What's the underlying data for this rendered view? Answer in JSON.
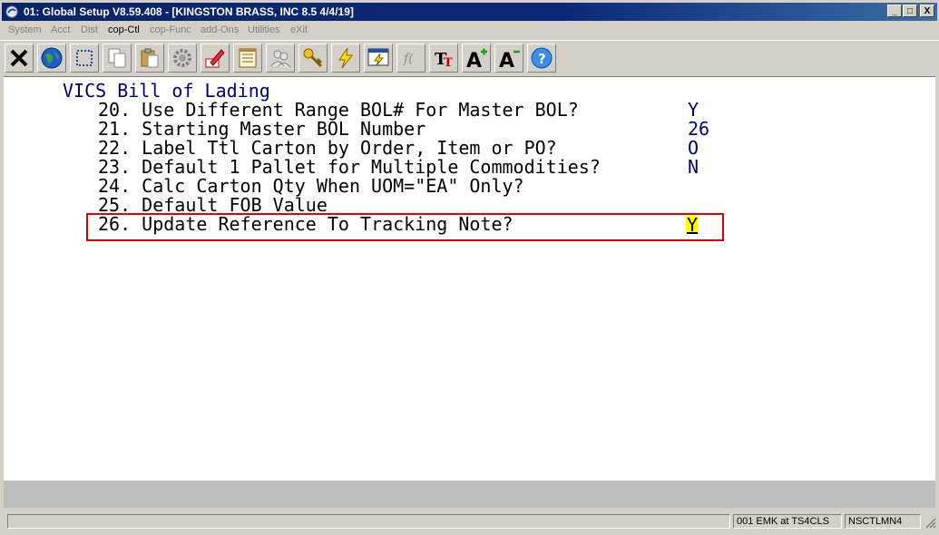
{
  "window": {
    "title": "01: Global Setup V8.59.408 - [KINGSTON BRASS, INC 8.5 4/4/19]",
    "controls": {
      "minimize": "_",
      "restore": "□",
      "close": "X"
    }
  },
  "menu": [
    {
      "label": "System",
      "enabled": false
    },
    {
      "label": "Acct",
      "enabled": false
    },
    {
      "label": "Dist",
      "enabled": false
    },
    {
      "label": "cop-Ctl",
      "enabled": true
    },
    {
      "label": "cop-Func",
      "enabled": false
    },
    {
      "label": "add-Ons",
      "enabled": false
    },
    {
      "label": "Utilities",
      "enabled": false
    },
    {
      "label": "eXit",
      "enabled": false
    }
  ],
  "toolbar_icons": [
    "close-x-icon",
    "globe-icon",
    "select-box-icon",
    "copy-icon",
    "paste-icon",
    "settings-gear-icon",
    "edit-pencil-icon",
    "notepad-icon",
    "users-icon",
    "key-icon",
    "lightning-icon",
    "screen-lightning-icon",
    "script-fx-icon",
    "font-tt-icon",
    "font-larger-icon",
    "font-smaller-icon",
    "help-icon"
  ],
  "screen": {
    "heading": "VICS Bill of Lading",
    "fields": [
      {
        "label": "20. Use Different Range BOL# For Master BOL?",
        "value": "Y"
      },
      {
        "label": "21. Starting Master BOL Number",
        "value": "26"
      },
      {
        "label": "22. Label Ttl Carton by Order, Item or PO?",
        "value": "O"
      },
      {
        "label": "23. Default 1 Pallet for Multiple Commodities?",
        "value": "N"
      },
      {
        "label": "24. Calc Carton Qty When UOM=\"EA\" Only?",
        "value": ""
      },
      {
        "label": "25. Default FOB Value",
        "value": ""
      },
      {
        "label": "26. Update Reference To Tracking Note?",
        "value": "Y"
      }
    ]
  },
  "status": {
    "left": "",
    "user": "001 EMK at TS4CLS",
    "program": "NSCTLMN4"
  },
  "colors": {
    "highlight_border": "#e00000",
    "cursor_bg": "#ffff00",
    "heading": "#000080"
  }
}
